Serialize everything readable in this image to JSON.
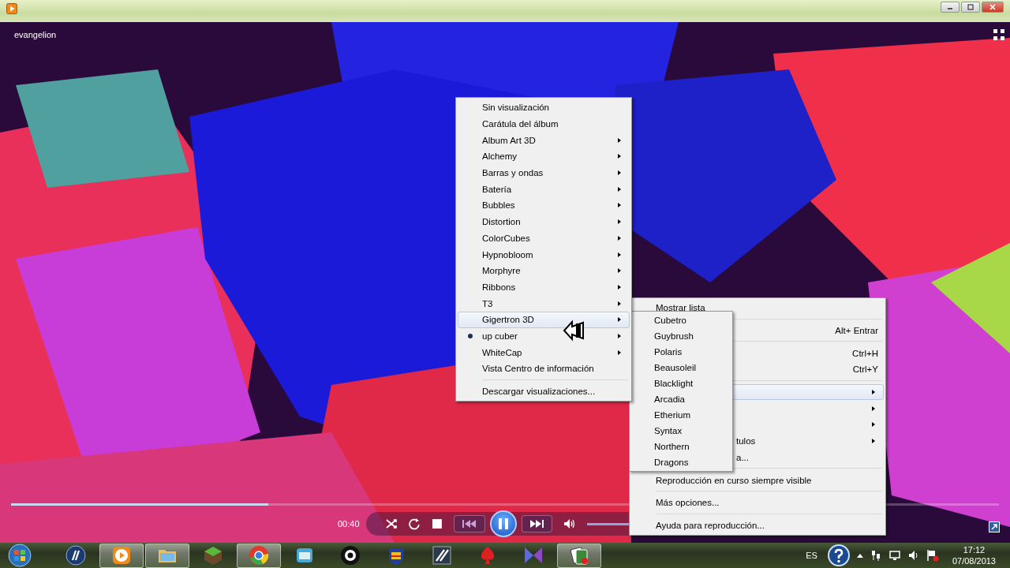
{
  "window": {
    "title": "evangelion"
  },
  "seek_bar": {
    "level": 0.26
  },
  "playback": {
    "time": "00:40",
    "playing": true
  },
  "visualization_menu": {
    "items": [
      {
        "kind": "item",
        "label": "Sin visualización",
        "has_submenu": false,
        "checked": false,
        "highlighted": false
      },
      {
        "kind": "item",
        "label": "Carátula del álbum",
        "has_submenu": false,
        "checked": false,
        "highlighted": false
      },
      {
        "kind": "item",
        "label": "Album Art 3D",
        "has_submenu": true,
        "checked": false,
        "highlighted": false
      },
      {
        "kind": "item",
        "label": "Alchemy",
        "has_submenu": true,
        "checked": false,
        "highlighted": false
      },
      {
        "kind": "item",
        "label": "Barras y ondas",
        "has_submenu": true,
        "checked": false,
        "highlighted": false
      },
      {
        "kind": "item",
        "label": "Batería",
        "has_submenu": true,
        "checked": false,
        "highlighted": false
      },
      {
        "kind": "item",
        "label": "Bubbles",
        "has_submenu": true,
        "checked": false,
        "highlighted": false
      },
      {
        "kind": "item",
        "label": "Distortion",
        "has_submenu": true,
        "checked": false,
        "highlighted": false
      },
      {
        "kind": "item",
        "label": "ColorCubes",
        "has_submenu": true,
        "checked": false,
        "highlighted": false
      },
      {
        "kind": "item",
        "label": "Hypnobloom",
        "has_submenu": true,
        "checked": false,
        "highlighted": false
      },
      {
        "kind": "item",
        "label": "Morphyre",
        "has_submenu": true,
        "checked": false,
        "highlighted": false
      },
      {
        "kind": "item",
        "label": "Ribbons",
        "has_submenu": true,
        "checked": false,
        "highlighted": false
      },
      {
        "kind": "item",
        "label": "T3",
        "has_submenu": true,
        "checked": false,
        "highlighted": false
      },
      {
        "kind": "item",
        "label": "Gigertron 3D",
        "has_submenu": true,
        "checked": false,
        "highlighted": true
      },
      {
        "kind": "item",
        "label": "up cuber",
        "has_submenu": true,
        "checked": true,
        "highlighted": false
      },
      {
        "kind": "item",
        "label": "WhiteCap",
        "has_submenu": true,
        "checked": false,
        "highlighted": false
      },
      {
        "kind": "item",
        "label": "Vista Centro de información",
        "has_submenu": false,
        "checked": false,
        "highlighted": false
      },
      {
        "kind": "separator"
      },
      {
        "kind": "item",
        "label": "Descargar visualizaciones...",
        "has_submenu": false,
        "checked": false,
        "highlighted": false
      }
    ]
  },
  "visualization_submenu": {
    "items": [
      {
        "label": "Cubetro"
      },
      {
        "label": "Guybrush"
      },
      {
        "label": "Polaris"
      },
      {
        "label": "Beausoleil"
      },
      {
        "label": "Blacklight"
      },
      {
        "label": "Arcadia"
      },
      {
        "label": "Etherium"
      },
      {
        "label": "Syntax"
      },
      {
        "label": "Northern"
      },
      {
        "label": "Dragons"
      }
    ]
  },
  "context_menu": {
    "items": [
      {
        "kind": "item",
        "label": "Mostrar lista",
        "covered": false,
        "has_submenu": false,
        "highlighted": false
      },
      {
        "kind": "separator"
      },
      {
        "kind": "item",
        "shortcut": "Alt+ Entrar",
        "has_submenu": false,
        "highlighted": false
      },
      {
        "kind": "separator"
      },
      {
        "kind": "item",
        "shortcut": "Ctrl+H",
        "has_submenu": false,
        "highlighted": false
      },
      {
        "kind": "item",
        "shortcut": "Ctrl+Y",
        "has_submenu": false,
        "highlighted": false
      },
      {
        "kind": "separator"
      },
      {
        "kind": "item",
        "has_submenu": true,
        "highlighted": true
      },
      {
        "kind": "item",
        "has_submenu": true,
        "highlighted": false
      },
      {
        "kind": "item",
        "has_submenu": true,
        "highlighted": false
      },
      {
        "kind": "item",
        "label": "tulos",
        "covered": true,
        "has_submenu": true,
        "highlighted": false
      },
      {
        "kind": "item",
        "label": "a...",
        "covered": true,
        "has_submenu": false,
        "highlighted": false
      },
      {
        "kind": "separator"
      },
      {
        "kind": "item",
        "label": "Reproducción en curso siempre visible",
        "covered": false,
        "has_submenu": false,
        "highlighted": false
      },
      {
        "kind": "separator"
      },
      {
        "kind": "item",
        "label": "Más opciones...",
        "covered": false,
        "has_submenu": false,
        "highlighted": false
      },
      {
        "kind": "separator"
      },
      {
        "kind": "item",
        "label": "Ayuda para reproducción...",
        "covered": false,
        "has_submenu": false,
        "highlighted": false
      }
    ]
  },
  "taskbar": {
    "buttons": [
      {
        "kind": "logo",
        "open": false
      },
      {
        "kind": "media",
        "open": true
      },
      {
        "kind": "folder",
        "open": true
      },
      {
        "kind": "cube",
        "open": false
      },
      {
        "kind": "browser",
        "open": true
      },
      {
        "kind": "window",
        "open": false
      },
      {
        "kind": "eye",
        "open": false
      },
      {
        "kind": "shield",
        "open": false
      },
      {
        "kind": "slashes",
        "open": false
      },
      {
        "kind": "spade",
        "open": false
      },
      {
        "kind": "bowtie",
        "open": false
      },
      {
        "kind": "cards",
        "open": true
      }
    ],
    "language": "ES",
    "clock": {
      "time": "17:12",
      "date": "07/08/2013"
    }
  }
}
